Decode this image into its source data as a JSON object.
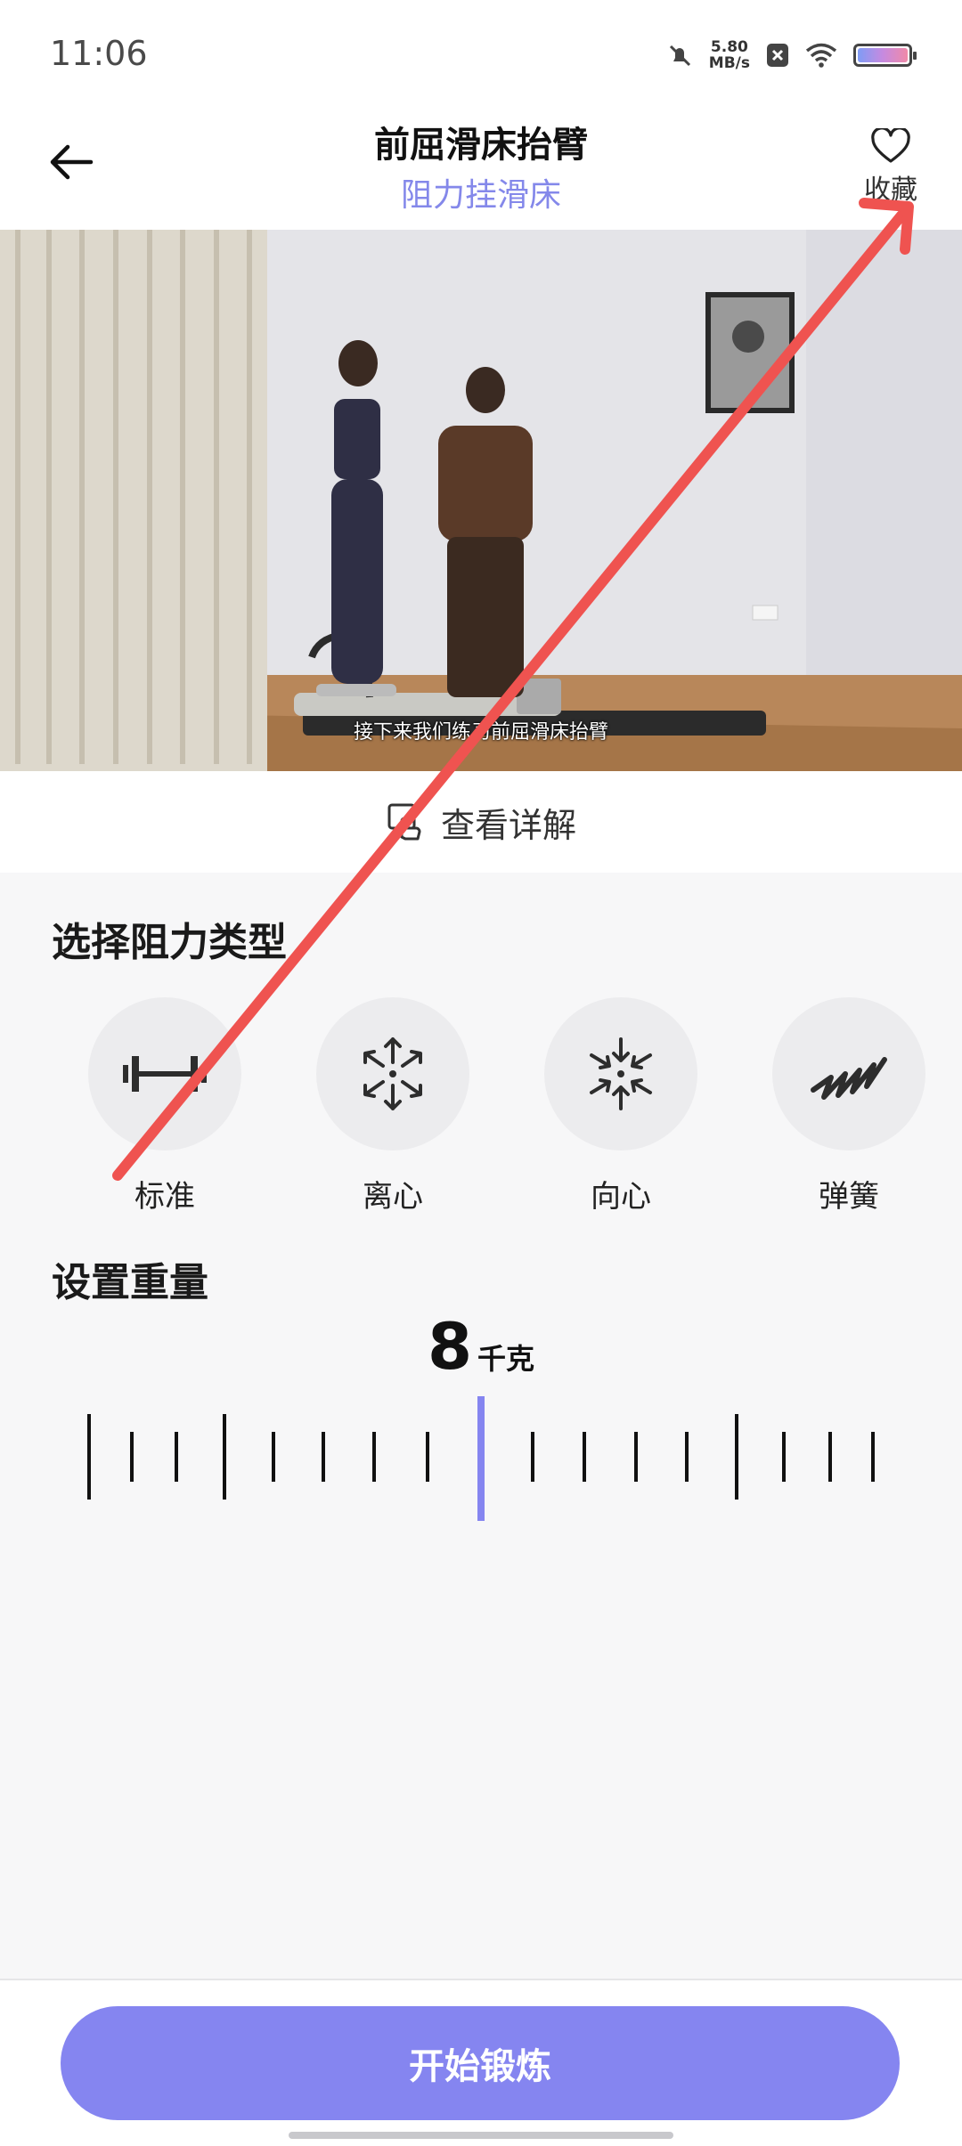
{
  "status_bar": {
    "time": "11:06",
    "net_speed_value": "5.80",
    "net_speed_unit": "MB/s",
    "icons": [
      "mute-icon",
      "x-badge-icon",
      "wifi-icon",
      "battery-icon"
    ]
  },
  "header": {
    "title": "前屈滑床抬臂",
    "subtitle": "阻力挂滑床",
    "favorite_label": "收藏"
  },
  "video": {
    "caption": "接下来我们练习前屈滑床抬臂"
  },
  "detail": {
    "label": "查看详解"
  },
  "resistance": {
    "title": "选择阻力类型",
    "types": [
      {
        "label": "标准",
        "icon": "dumbbell-icon"
      },
      {
        "label": "离心",
        "icon": "expand-arrows-icon"
      },
      {
        "label": "向心",
        "icon": "collapse-arrows-icon"
      },
      {
        "label": "弹簧",
        "icon": "spring-icon"
      }
    ]
  },
  "weight": {
    "title": "设置重量",
    "value": "8",
    "unit": "千克"
  },
  "actions": {
    "start_label": "开始锻炼"
  },
  "colors": {
    "accent": "#8585f0",
    "subtitle": "#8488ea",
    "annotation": "#ef5350"
  }
}
